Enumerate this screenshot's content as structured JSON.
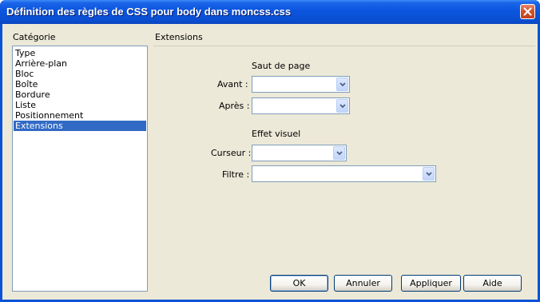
{
  "window": {
    "title": "Définition des règles de CSS pour body dans moncss.css"
  },
  "category": {
    "label": "Catégorie",
    "items": [
      "Type",
      "Arrière-plan",
      "Bloc",
      "Boîte",
      "Bordure",
      "Liste",
      "Positionnement",
      "Extensions"
    ],
    "selected": "Extensions"
  },
  "panel": {
    "title": "Extensions",
    "page_break": {
      "heading": "Saut de page",
      "before_label": "Avant :",
      "before_value": "",
      "after_label": "Après :",
      "after_value": ""
    },
    "visual_effect": {
      "heading": "Effet visuel",
      "cursor_label": "Curseur :",
      "cursor_value": "",
      "filter_label": "Filtre :",
      "filter_value": ""
    }
  },
  "buttons": {
    "ok": "OK",
    "cancel": "Annuler",
    "apply": "Appliquer",
    "help": "Aide"
  },
  "icons": {
    "close": "close-icon",
    "dropdown": "chevron-down-icon"
  },
  "colors": {
    "titlebar": "#0a52d6",
    "selection": "#316ac5",
    "dialog_bg": "#ece9d8",
    "close_button": "#d4532f"
  }
}
